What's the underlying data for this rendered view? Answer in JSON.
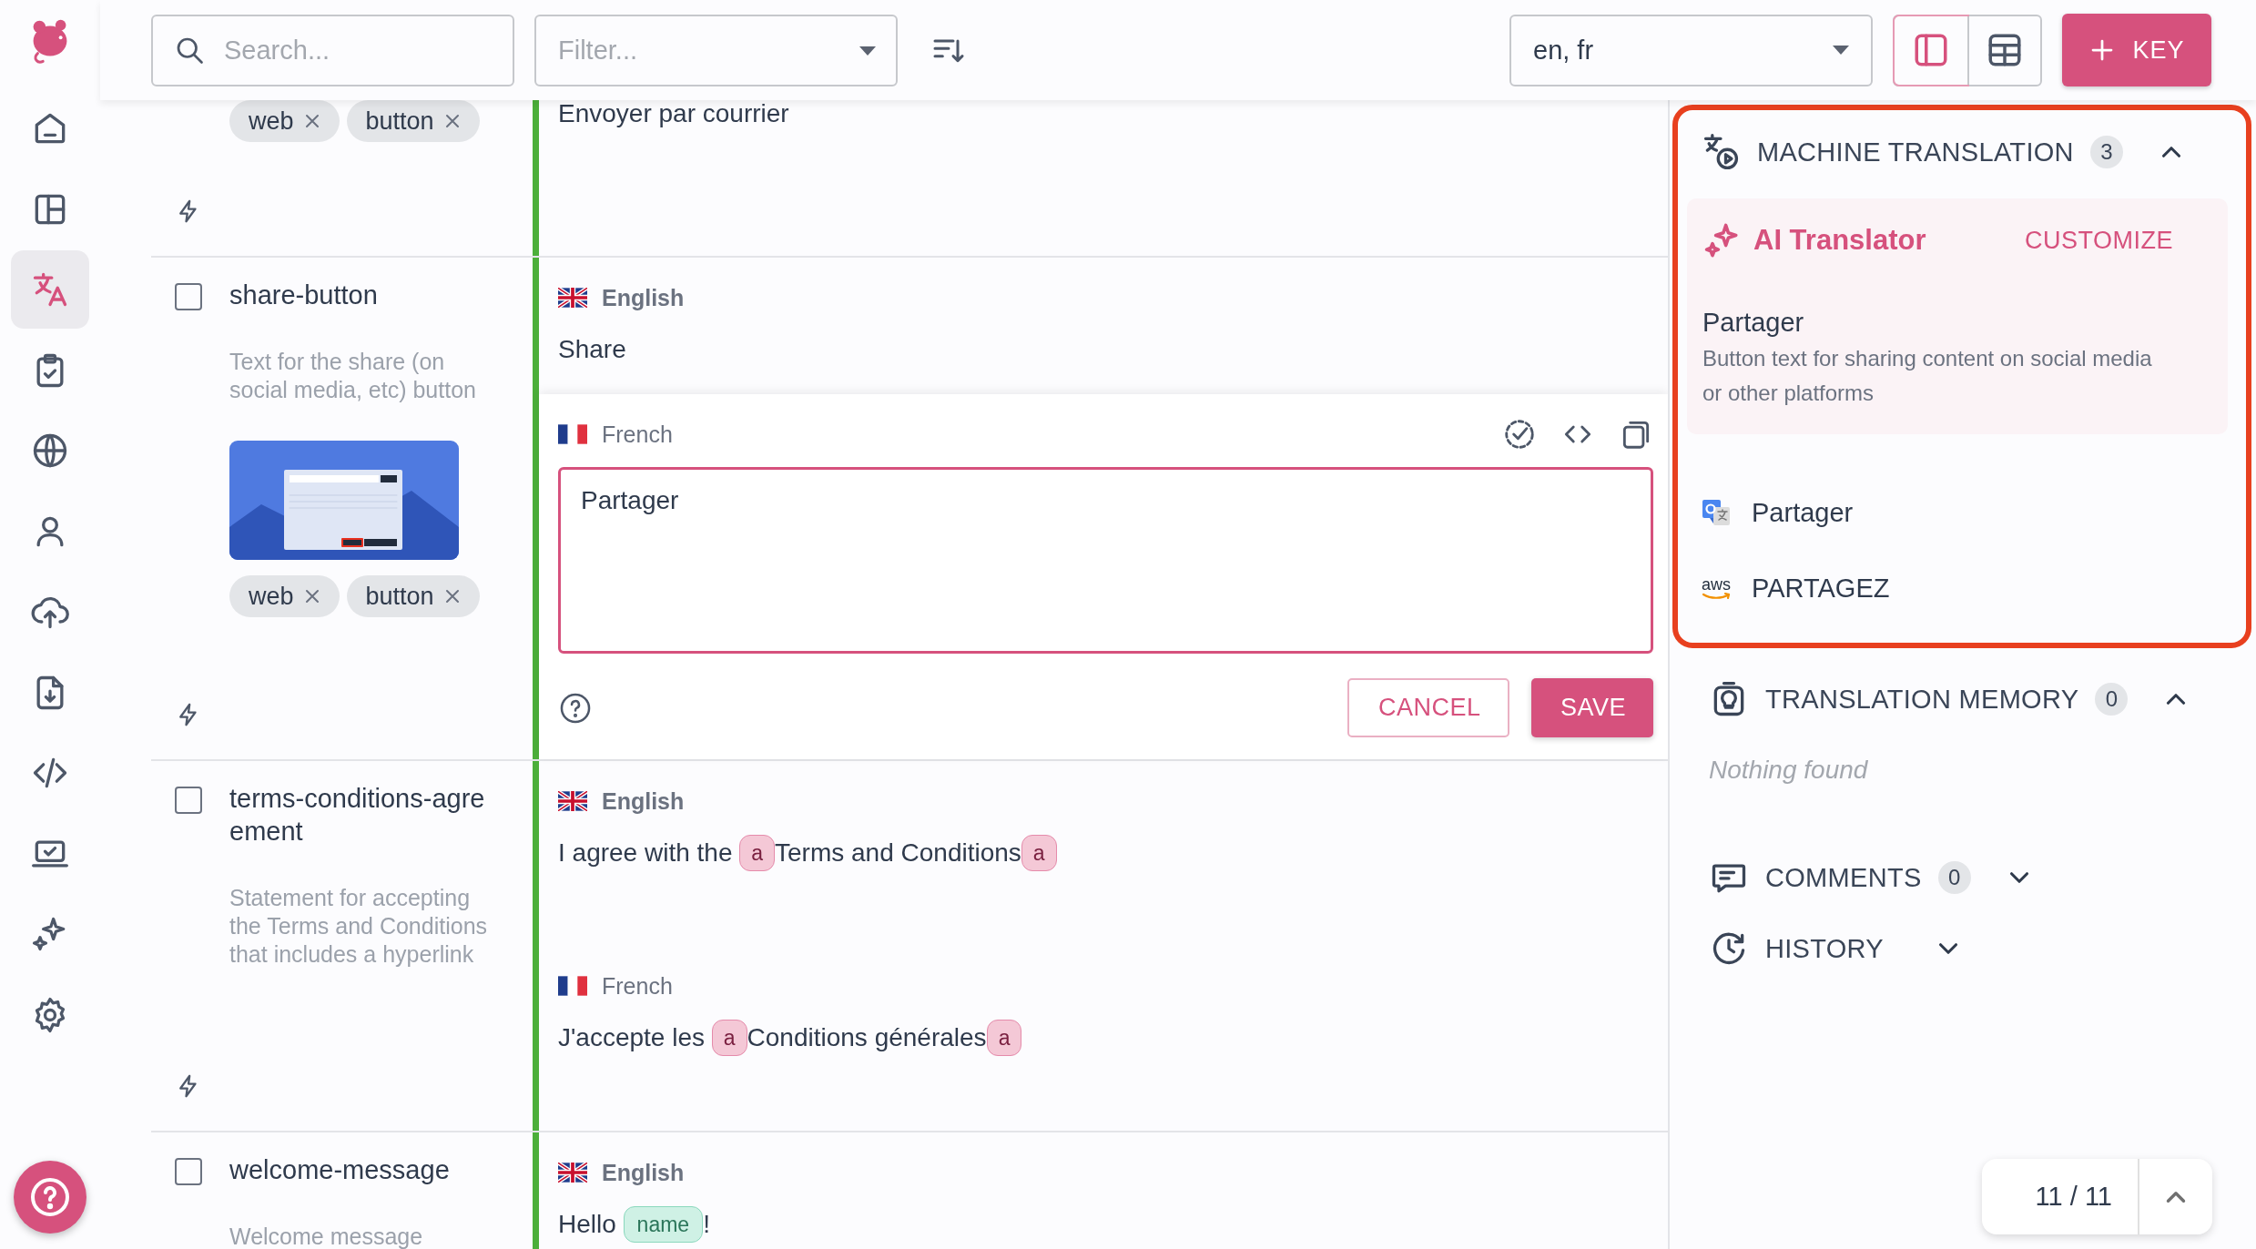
{
  "sidebar": {
    "items": [
      {
        "selected": false
      },
      {
        "selected": false
      },
      {
        "selected": true
      },
      {
        "selected": false
      },
      {
        "selected": false
      },
      {
        "selected": false
      },
      {
        "selected": false
      },
      {
        "selected": false
      },
      {
        "selected": false
      },
      {
        "selected": false
      },
      {
        "selected": false
      },
      {
        "selected": false
      }
    ]
  },
  "toolbar": {
    "search": {
      "placeholder": "Search..."
    },
    "filter": {
      "placeholder": "Filter..."
    },
    "languages": {
      "value": "en, fr"
    },
    "view_modes": [
      {
        "selected": true
      },
      {
        "selected": false
      }
    ],
    "add_button": {
      "label": "KEY"
    }
  },
  "keys": [
    {
      "tags": [
        "web",
        "button"
      ],
      "translations": [
        {
          "kind": "text",
          "segments": [
            {
              "kind": "text",
              "text": "Envoyer par courrier"
            }
          ]
        }
      ]
    },
    {
      "name": "share-button",
      "checked": false,
      "description": "Text for the share (on social media, etc) button",
      "screenshot": true,
      "tags": [
        "web",
        "button"
      ],
      "translations": [
        {
          "kind": "text",
          "flag": {
            "kind": "gb"
          },
          "language": "English",
          "base": true,
          "segments": [
            {
              "kind": "text",
              "text": "Share"
            }
          ]
        },
        {
          "kind": "editor",
          "flag": {
            "kind": "fr"
          },
          "language": "French",
          "base": false,
          "value": "Partager",
          "buttons": [
            {
              "kind": "secondary",
              "label": "CANCEL"
            },
            {
              "kind": "primary",
              "label": "SAVE"
            }
          ]
        }
      ]
    },
    {
      "name": "terms-conditions-agreement",
      "checked": false,
      "description": "Statement for accepting the Terms and Conditions that includes a hyperlink",
      "translations": [
        {
          "kind": "text",
          "flag": {
            "kind": "gb"
          },
          "language": "English",
          "base": true,
          "segments": [
            {
              "kind": "text",
              "text": "I agree with the "
            },
            {
              "kind": "tag",
              "text": "a"
            },
            {
              "kind": "text",
              "text": "Terms and Conditions"
            },
            {
              "kind": "tag",
              "text": "a"
            }
          ]
        },
        {
          "kind": "text",
          "flag": {
            "kind": "fr"
          },
          "language": "French",
          "base": false,
          "segments": [
            {
              "kind": "text",
              "text": "J'accepte les "
            },
            {
              "kind": "tag",
              "text": "a"
            },
            {
              "kind": "text",
              "text": "Conditions générales"
            },
            {
              "kind": "tag",
              "text": "a"
            }
          ]
        }
      ]
    },
    {
      "name": "welcome-message",
      "checked": false,
      "description": "Welcome message",
      "translations": [
        {
          "kind": "text",
          "flag": {
            "kind": "gb"
          },
          "language": "English",
          "base": true,
          "segments": [
            {
              "kind": "text",
              "text": "Hello "
            },
            {
              "kind": "variable",
              "text": "name"
            },
            {
              "kind": "text",
              "text": "!"
            }
          ]
        }
      ]
    }
  ],
  "side_panel": {
    "sections": [
      {
        "kind": "machine_translation",
        "title": "MACHINE TRANSLATION",
        "count": "3",
        "expanded": true,
        "highlighted": true,
        "results": [
          {
            "kind": "ai",
            "title": "AI Translator",
            "action": "CUSTOMIZE",
            "text": "Partager",
            "description": "Button text for sharing content on social media or other platforms"
          },
          {
            "kind": "google",
            "text": "Partager"
          },
          {
            "kind": "aws",
            "logo": "aws",
            "text": "PARTAGEZ"
          }
        ]
      },
      {
        "kind": "memory",
        "title": "TRANSLATION MEMORY",
        "count": "0",
        "expanded": true,
        "highlighted": false,
        "empty_text": "Nothing found"
      },
      {
        "kind": "comments",
        "title": "COMMENTS",
        "count": "0",
        "expanded": false,
        "highlighted": false
      },
      {
        "kind": "history",
        "title": "HISTORY",
        "expanded": false,
        "highlighted": false
      }
    ]
  },
  "pager": {
    "text": "11 / 11"
  }
}
